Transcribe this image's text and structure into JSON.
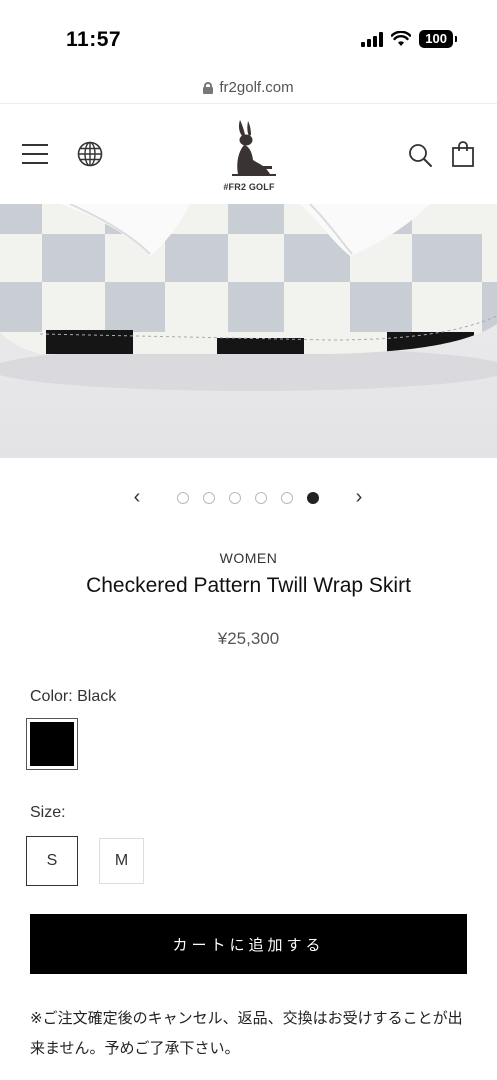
{
  "status_bar": {
    "time": "11:57",
    "battery": "100"
  },
  "browser": {
    "url": "fr2golf.com"
  },
  "header": {
    "logo_text": "#FR2 GOLF",
    "icons": [
      "menu-icon",
      "globe-icon",
      "search-icon",
      "bag-icon"
    ]
  },
  "carousel": {
    "prev": "‹",
    "next": "›",
    "total": 6,
    "active": 6
  },
  "product": {
    "category": "WOMEN",
    "title": "Checkered Pattern Twill Wrap Skirt",
    "price": "¥25,300",
    "color_label": "Color: Black",
    "color_value": "#000000",
    "size_label": "Size:",
    "sizes": [
      "S",
      "M"
    ],
    "selected_size": "S",
    "add_to_cart": "カートに追加する",
    "notice": "※ご注文確定後のキャンセル、返品、交換はお受けすることが出来ません。予めご了承下さい。"
  }
}
